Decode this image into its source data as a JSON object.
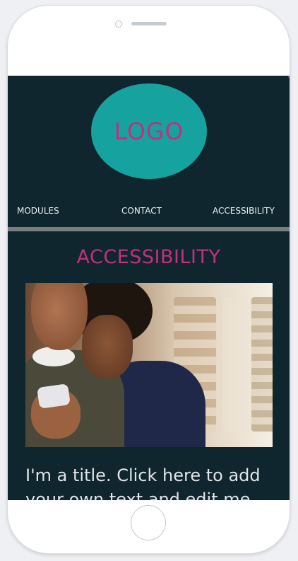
{
  "logo": {
    "text": "LOGO"
  },
  "nav": {
    "items": [
      {
        "label": "MODULES"
      },
      {
        "label": "CONTACT"
      },
      {
        "label": "ACCESSIBILITY"
      }
    ]
  },
  "section": {
    "title": "ACCESSIBILITY"
  },
  "post": {
    "title": "I'm a title. Click here to add your own text and edit me."
  },
  "colors": {
    "background": "#10262e",
    "logo_fill": "#16a3a0",
    "accent": "#c2307e",
    "divider": "#7a7e80"
  },
  "icons": {
    "camera": "camera-icon",
    "speaker": "speaker-icon",
    "home": "home-button-icon"
  }
}
